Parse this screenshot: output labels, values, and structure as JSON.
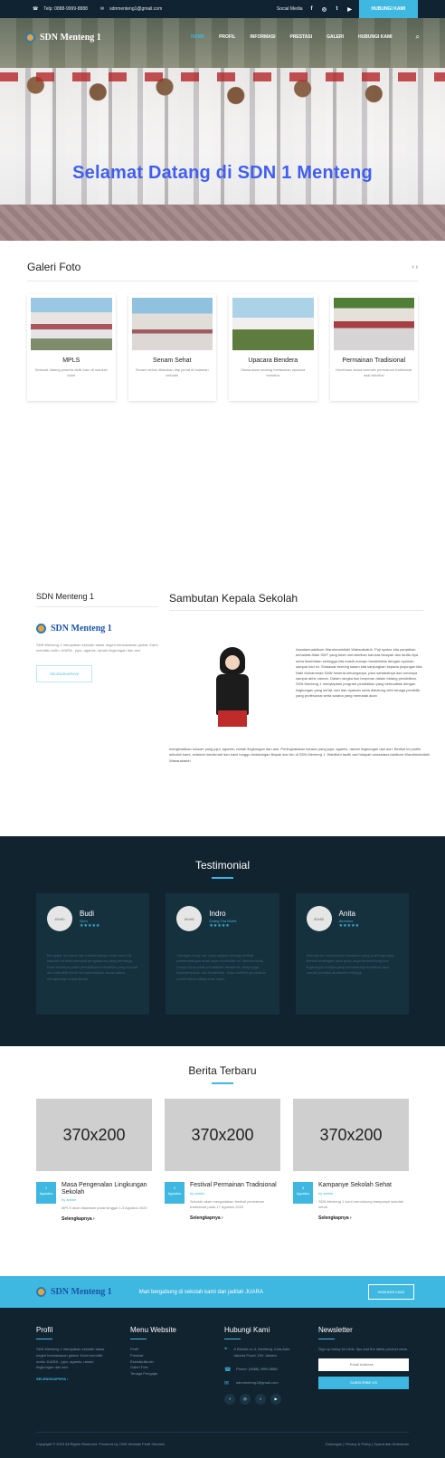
{
  "topbar": {
    "phone": "Telp: 0888-9999-8888",
    "email": "sdnmenteng1@gmail.com",
    "social_label": "Social Media",
    "cta": "HUBUNGI KAMI",
    "social_icons": [
      "facebook-icon",
      "instagram-icon",
      "twitter-icon",
      "youtube-icon"
    ]
  },
  "nav": {
    "logo": "SDN Menteng 1",
    "items": [
      "HOME",
      "PROFIL",
      "INFORMASI",
      "PRESTASI",
      "GALERI",
      "HUBUNGI KAMI"
    ],
    "search_icon": "search-icon"
  },
  "hero": {
    "title": "Selamat Datang di SDN 1 Menteng"
  },
  "gallery": {
    "title": "Galeri Foto",
    "arrows": "‹ ›",
    "items": [
      {
        "title": "MPLS",
        "desc": "Selamat datang peserta didik baru di sekolah kami"
      },
      {
        "title": "Senam Sehat",
        "desc": "Senam sehat dilakukan tiap jumat di halaman sekolah"
      },
      {
        "title": "Upacara Bendera",
        "desc": "Siswa-siswi sedang melakukan upacara bendera"
      },
      {
        "title": "Permainan Tradisional",
        "desc": "Keceriaan siswa bermain permainan tradisional saat istirahat"
      }
    ]
  },
  "about": {
    "school_title": "SDN Menteng 1",
    "logo": "SDN Menteng 1",
    "description": "SDN Menteng 1 merupakan sekolah dasar negeri berwawasan global. Kami memiliki motto JUARA - jujur, agamis, ramah lingkungan dan asri.",
    "button": "SELENGKAPNYA",
    "headline": "Sambutan Kepala Sekolah",
    "text_right": "Assalamualaikum Warahmatullahi Wabarakatuh. Puji syukur kita panjatkan kehadirat Allah SWT yang telah memberikan karunia hidayah dan taufik-Nya serta kesehatan sehingga kita masih mampu beraktivitas dengan nyaman sampai hari ini. Shalawat beriring salam kita sanjungkan kepada junjungan kita Nabi Muhammad SAW beserta keluarganya, para sahabatnya dan umatnya sampai akhir zaman. Dalam rangka ikut berperan dalam bidang pendidikan, SDN Menteng 1 menyiapkan program pendidikan yang berkualitas dengan lingkungan yang sehat, asri dan nyaman serta didukung oleh tenaga pendidik yang profesional serta sarana yang memadai akan",
    "text_bottom": "menghasilkan lulusan yang jujur, agamis, ramah lingkungan dan asri. Perlingnatakan lulusan yang jujur, agamis, ramah lingkungan dan asri. Berikut ini profile sekolah kami, selamat menikmati dan kami tunggu kedatangan Bapak dan Ibu di SDN Menteng 1. Wabillahi taufik wal hidayah wassalamu'alaikum Warahmatullahi Wabarakatuh"
  },
  "testimonials": {
    "title": "Testimonial",
    "items": [
      {
        "avatar": "80x80",
        "name": "Budi",
        "role": "Guru",
        "stars": "★★★★★",
        "text": "Mengajar bersama dan mendampingi murid-murid di sekolah ini telah menjadi pengalaman yang berharga. Kami berfokus pada pendidikan berkualitas yang inovatif dan interaktif untuk mempersiapkan siswa dalam menghadapi masa depan."
      },
      {
        "avatar": "80x80",
        "name": "Indro",
        "role": "Orang Tua Murid",
        "stars": "★★★★★",
        "text": "Sebagai orang tua, saya sangat senang melihat perkembangan anak saya di sekolah ini. Mereka tidak hanya fokus pada pendidikan akademis, tetapi juga kepemimpinan dan kreativitas. Saya melihat perubahan positif dalam sikap anak saya."
      },
      {
        "avatar": "80x80",
        "name": "Anita",
        "role": "Alumnus",
        "stars": "★★★★★",
        "text": "Sekolah ini memberikan landasan yang kuat bagi saya. Berkat bimbingan para guru, saya berkembang dan lingkungan belajar yang mendukung membuat saya meraih prestasi akademis tertinggi."
      }
    ]
  },
  "news": {
    "title": "Berita Terbaru",
    "placeholder": "370x200",
    "items": [
      {
        "day": "1",
        "month": "Agustus",
        "title": "Masa Pengenalan Lingkungan Sekolah",
        "by": "by admin",
        "excerpt": "MPLS akan diadakan pada tanggal 1-3 Agustus 2023",
        "link": "Selengkapnya ›"
      },
      {
        "day": "2",
        "month": "Agustus",
        "title": "Festival Permainan Tradisional",
        "by": "by admin",
        "excerpt": "Sekolah akan mengadakan festival permainan tradisional pada 17 Agustus 2023",
        "link": "Selengkapnya ›"
      },
      {
        "day": "3",
        "month": "Agustus",
        "title": "Kampanye Sekolah Sehat",
        "by": "by admin",
        "excerpt": "SDN Menteng 1 turut mendukung kampanye sekolah sehat",
        "link": "Selengkapnya ›"
      }
    ]
  },
  "cta": {
    "logo": "SDN Menteng 1",
    "text": "Mari bergabung di sekolah kami dan jadilah JUARA",
    "button": "HUBUNGI KAMI"
  },
  "footer": {
    "profil_title": "Profil",
    "profil_text": "SDN Menteng 1 merupakan sekolah dasar negeri berwawasan global. Kami memiliki motto JUARA - jujur, agamis, ramah lingkungan dan asri.",
    "profil_more": "SELENGKAPNYA ›",
    "menu_title": "Menu Website",
    "menu_items": [
      "Profil",
      "Prestasi",
      "Ekstrakulikuler",
      "Galeri Foto",
      "Tenaga Pengajar"
    ],
    "contact_title": "Hubungi Kami",
    "address": "Jl Besuki no 4, Menteng, Kota Adm Jakarta Pusat, DKI Jakarta",
    "phone": "Phone: (0888) 9999-8888",
    "email": "sdnmenteng1@gmail.com",
    "social_icons": [
      "f",
      "◎",
      "t",
      "▶"
    ],
    "newsletter_title": "Newsletter",
    "newsletter_text": "Sign up today for hints, tips and the latest product news",
    "email_placeholder": "Email Address",
    "subscribe": "SUBSCRIBE US",
    "copyright": "Copyright © 2023 All Rights Reserved. Powered by CMS Website Profil Sekolah",
    "links": "Dukungan | Privacy & Policy | Syarat dan Ketentuan"
  }
}
